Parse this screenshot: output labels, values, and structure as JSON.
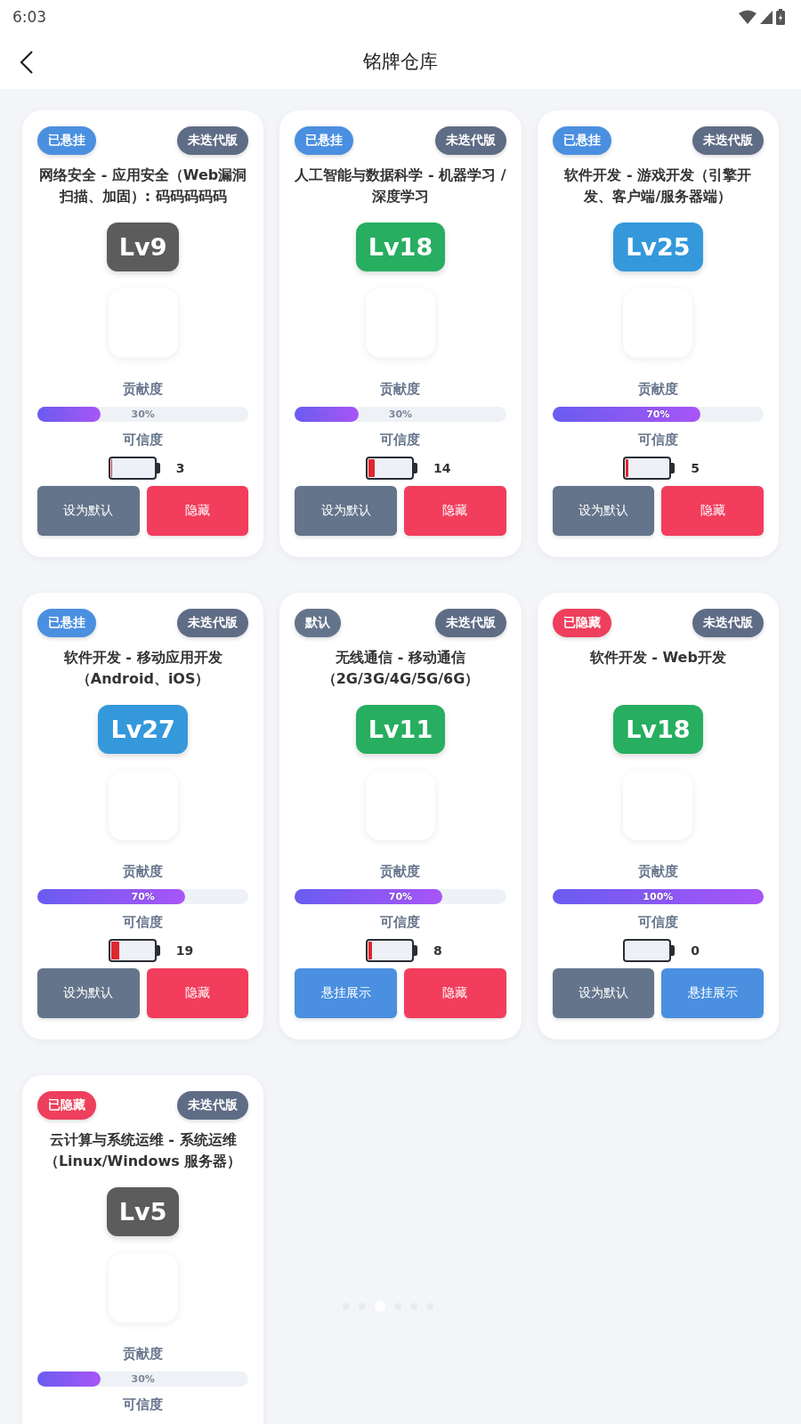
{
  "status_bar": {
    "time": "6:03"
  },
  "header": {
    "title": "铭牌仓库"
  },
  "cards": [
    {
      "status": {
        "label": "已悬挂",
        "kind": "hung"
      },
      "version": "未迭代版",
      "title": "网络安全 - 应用安全（Web漏洞扫描、加固）: 码码码码码",
      "level_badge": {
        "label": "Lv9",
        "color": "#5c5c5c"
      },
      "contribution": {
        "label": "贡献度",
        "level": 0.3,
        "reading": "30%"
      },
      "credibility": {
        "label": "可信度",
        "level": 0.03,
        "reading": "3"
      },
      "buttons": [
        {
          "label": "设为默认",
          "kind": "neutral"
        },
        {
          "label": "隐藏",
          "kind": "danger"
        }
      ]
    },
    {
      "status": {
        "label": "已悬挂",
        "kind": "hung"
      },
      "version": "未迭代版",
      "title": "人工智能与数据科学 - 机器学习 / 深度学习",
      "level_badge": {
        "label": "Lv18",
        "color": "#27ae60"
      },
      "contribution": {
        "label": "贡献度",
        "level": 0.3,
        "reading": "30%"
      },
      "credibility": {
        "label": "可信度",
        "level": 0.14,
        "reading": "14"
      },
      "buttons": [
        {
          "label": "设为默认",
          "kind": "neutral"
        },
        {
          "label": "隐藏",
          "kind": "danger"
        }
      ]
    },
    {
      "status": {
        "label": "已悬挂",
        "kind": "hung"
      },
      "version": "未迭代版",
      "title": "软件开发 - 游戏开发（引擎开发、客户端/服务器端）",
      "level_badge": {
        "label": "Lv25",
        "color": "#3498db"
      },
      "contribution": {
        "label": "贡献度",
        "level": 0.7,
        "reading": "70%"
      },
      "credibility": {
        "label": "可信度",
        "level": 0.05,
        "reading": "5"
      },
      "buttons": [
        {
          "label": "设为默认",
          "kind": "neutral"
        },
        {
          "label": "隐藏",
          "kind": "danger"
        }
      ]
    },
    {
      "status": {
        "label": "已悬挂",
        "kind": "hung"
      },
      "version": "未迭代版",
      "title": "软件开发 - 移动应用开发（Android、iOS）",
      "level_badge": {
        "label": "Lv27",
        "color": "#3498db"
      },
      "contribution": {
        "label": "贡献度",
        "level": 0.7,
        "reading": "70%"
      },
      "credibility": {
        "label": "可信度",
        "level": 0.19,
        "reading": "19"
      },
      "buttons": [
        {
          "label": "设为默认",
          "kind": "neutral"
        },
        {
          "label": "隐藏",
          "kind": "danger"
        }
      ]
    },
    {
      "status": {
        "label": "默认",
        "kind": "default"
      },
      "version": "未迭代版",
      "title": "无线通信 - 移动通信（2G/3G/4G/5G/6G）",
      "level_badge": {
        "label": "Lv11",
        "color": "#27ae60"
      },
      "contribution": {
        "label": "贡献度",
        "level": 0.7,
        "reading": "70%"
      },
      "credibility": {
        "label": "可信度",
        "level": 0.08,
        "reading": "8"
      },
      "buttons": [
        {
          "label": "悬挂展示",
          "kind": "primary"
        },
        {
          "label": "隐藏",
          "kind": "danger"
        }
      ]
    },
    {
      "status": {
        "label": "已隐藏",
        "kind": "hidden"
      },
      "version": "未迭代版",
      "title": "软件开发 - Web开发",
      "level_badge": {
        "label": "Lv18",
        "color": "#27ae60"
      },
      "contribution": {
        "label": "贡献度",
        "level": 1,
        "reading": "100%"
      },
      "credibility": {
        "label": "可信度",
        "level": 0,
        "reading": "0"
      },
      "buttons": [
        {
          "label": "设为默认",
          "kind": "neutral"
        },
        {
          "label": "悬挂展示",
          "kind": "primary"
        }
      ]
    },
    {
      "status": {
        "label": "已隐藏",
        "kind": "hidden"
      },
      "version": "未迭代版",
      "title": "云计算与系统运维 - 系统运维（Linux/Windows 服务器）",
      "level_badge": {
        "label": "Lv5",
        "color": "#5c5c5c"
      },
      "contribution": {
        "label": "贡献度",
        "level": 0.3,
        "reading": "30%"
      },
      "credibility": {
        "label": "可信度"
      }
    }
  ]
}
